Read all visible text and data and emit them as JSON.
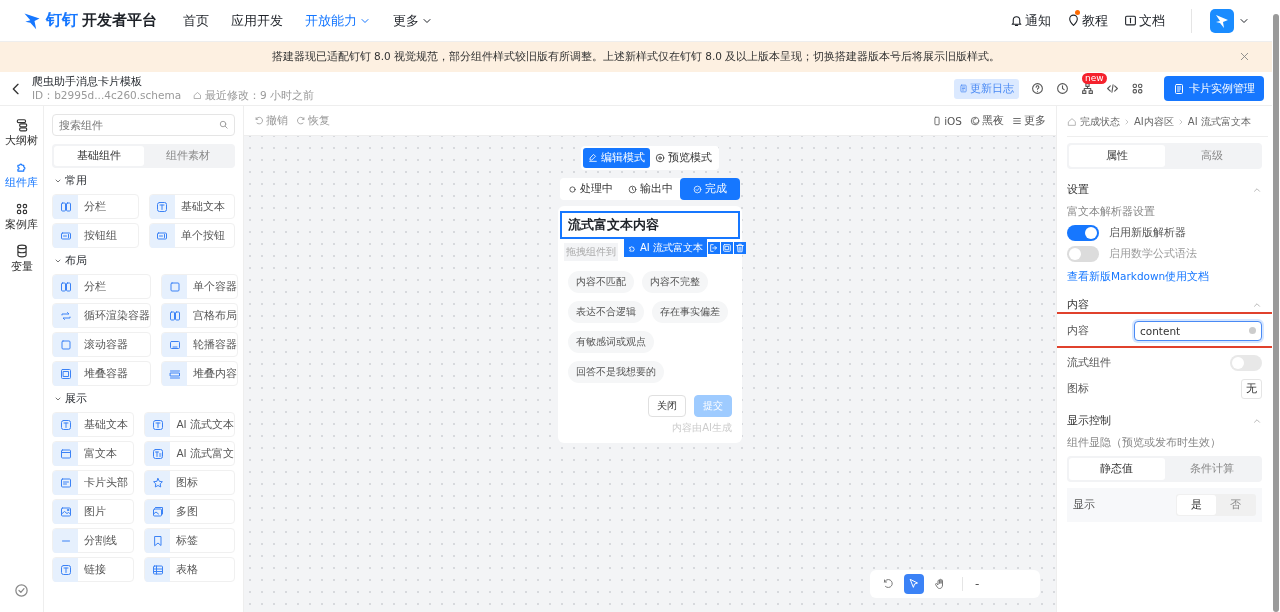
{
  "nav": {
    "brand_mark": "钉钉",
    "brand": "开发者平台",
    "items": [
      {
        "label": "首页",
        "selected": false,
        "dropdown": false
      },
      {
        "label": "应用开发",
        "selected": false,
        "dropdown": false
      },
      {
        "label": "开放能力",
        "selected": true,
        "dropdown": true
      },
      {
        "label": "更多",
        "selected": false,
        "dropdown": true
      }
    ],
    "actions": [
      {
        "label": "通知",
        "dot": false
      },
      {
        "label": "教程",
        "dot": true
      },
      {
        "label": "文档",
        "dot": false
      }
    ]
  },
  "banner": {
    "text": "搭建器现已适配钉钉 8.0 视觉规范，部分组件样式较旧版有所调整。上述新样式仅在钉钉 8.0 及以上版本呈现；切换搭建器版本号后将展示旧版样式。"
  },
  "header": {
    "title": "爬虫助手消息卡片模板",
    "id": "ID：b2995d...4c260.schema",
    "modified": "最近修改：9 小时之前",
    "changelog": "更新日志",
    "new_badge": "new",
    "primary_button": "卡片实例管理"
  },
  "rail": [
    {
      "label": "大纲树",
      "selected": false
    },
    {
      "label": "组件库",
      "selected": true
    },
    {
      "label": "案例库",
      "selected": false
    },
    {
      "label": "变量",
      "selected": false
    }
  ],
  "library": {
    "search_placeholder": "搜索组件",
    "tabs": [
      {
        "label": "基础组件",
        "selected": true
      },
      {
        "label": "组件素材",
        "selected": false
      }
    ],
    "groups": [
      {
        "title": "常用",
        "expanded": true,
        "items": [
          "分栏",
          "基础文本",
          "按钮组",
          "单个按钮"
        ]
      },
      {
        "title": "布局",
        "expanded": true,
        "items": [
          "分栏",
          "单个容器",
          "循环渲染容器",
          "宫格布局",
          "滚动容器",
          "轮播容器",
          "堆叠容器",
          "堆叠内容"
        ]
      },
      {
        "title": "展示",
        "expanded": true,
        "items": [
          "基础文本",
          "AI 流式文本",
          "富文本",
          "AI 流式富文",
          "卡片头部",
          "图标",
          "图片",
          "多图",
          "分割线",
          "标签",
          "链接",
          "表格"
        ]
      }
    ]
  },
  "canvas_toolbar": {
    "undo": "撤销",
    "redo": "恢复",
    "platform": "iOS",
    "theme": "黑夜",
    "more": "更多"
  },
  "canvas": {
    "modes": [
      {
        "label": "编辑模式",
        "selected": true
      },
      {
        "label": "预览模式",
        "selected": false
      }
    ],
    "states": [
      {
        "label": "处理中",
        "selected": false
      },
      {
        "label": "输出中",
        "selected": false
      },
      {
        "label": "完成",
        "selected": true
      }
    ],
    "card": {
      "title": "流式富文本内容",
      "selected_tag": "AI 流式富文本",
      "drop_hint": "拖拽组件到",
      "chips": [
        "内容不匹配",
        "内容不完整",
        "表达不合逻辑",
        "存在事实偏差",
        "有敏感词或观点",
        "回答不是我想要的"
      ],
      "buttons": [
        {
          "label": "关闭",
          "kind": "default",
          "disabled": false
        },
        {
          "label": "提交",
          "kind": "primary",
          "disabled": true
        }
      ],
      "footnote": "内容由AI生成"
    }
  },
  "zoom_bar": {
    "tools": [
      {
        "selected": false
      },
      {
        "selected": true
      },
      {
        "selected": false
      }
    ],
    "zoom_out": "-"
  },
  "inspector": {
    "breadcrumb": [
      "完成状态",
      "AI内容区",
      "AI 流式富文本"
    ],
    "tabs": [
      {
        "label": "属性",
        "selected": true
      },
      {
        "label": "高级",
        "selected": false
      }
    ],
    "sections": [
      {
        "title": "设置",
        "expanded": true,
        "rows": [
          {
            "kind": "caption",
            "label": "富文本解析器设置"
          },
          {
            "kind": "switch",
            "label": "启用新版解析器",
            "on": true,
            "disabled": false
          },
          {
            "kind": "switch",
            "label": "启用数学公式语法",
            "on": false,
            "disabled": true
          },
          {
            "kind": "link",
            "label": "查看新版Markdown使用文档"
          }
        ]
      },
      {
        "title": "内容",
        "expanded": true,
        "rows": [
          {
            "kind": "input",
            "label": "内容",
            "value": "content",
            "highlighted": true
          },
          {
            "kind": "switch_row",
            "label": "流式组件",
            "on": false
          },
          {
            "kind": "picker",
            "label": "图标",
            "value": "无"
          }
        ]
      },
      {
        "title": "显示控制",
        "expanded": true,
        "rows": [
          {
            "kind": "caption",
            "label": "组件显隐（预览或发布时生效）"
          },
          {
            "kind": "segmented",
            "options": [
              {
                "label": "静态值",
                "selected": true
              },
              {
                "label": "条件计算",
                "selected": false
              }
            ]
          },
          {
            "kind": "choice",
            "label": "显示",
            "options": [
              {
                "label": "是",
                "selected": true
              },
              {
                "label": "否",
                "selected": false
              }
            ]
          }
        ]
      }
    ]
  }
}
